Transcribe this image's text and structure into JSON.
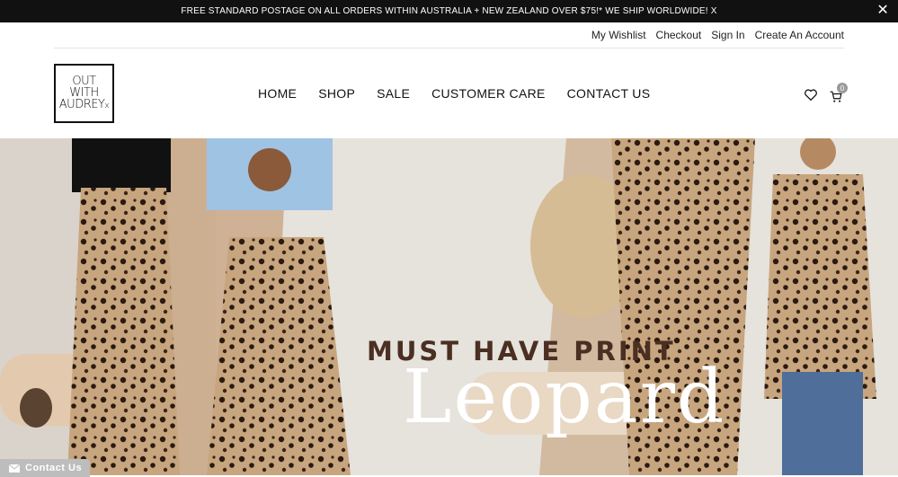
{
  "announcement": {
    "text": "FREE STANDARD POSTAGE ON ALL ORDERS WITHIN AUSTRALIA + NEW ZEALAND OVER $75!* WE SHIP WORLDWIDE! X",
    "close_icon": "close-icon"
  },
  "account_links": [
    "My Wishlist",
    "Checkout",
    "Sign In",
    "Create An Account"
  ],
  "logo": {
    "line1": "OUT",
    "line2": "WITH",
    "line3": "AUDREY",
    "mark": "x"
  },
  "nav": [
    "HOME",
    "SHOP",
    "SALE",
    "CUSTOMER CARE",
    "CONTACT US"
  ],
  "header_icons": {
    "wishlist": "heart-icon",
    "cart": "cart-icon",
    "cart_count": "0"
  },
  "hero": {
    "tagline": "MUST HAVE PRINT",
    "title": "Leopard"
  },
  "contact_tab": {
    "label": "Contact Us",
    "icon": "envelope-icon"
  },
  "colors": {
    "announce_bg": "#111111",
    "tagline": "#4a2f22",
    "hero_title": "#ffffff",
    "contact_tab_bg": "#bdbdbd"
  }
}
